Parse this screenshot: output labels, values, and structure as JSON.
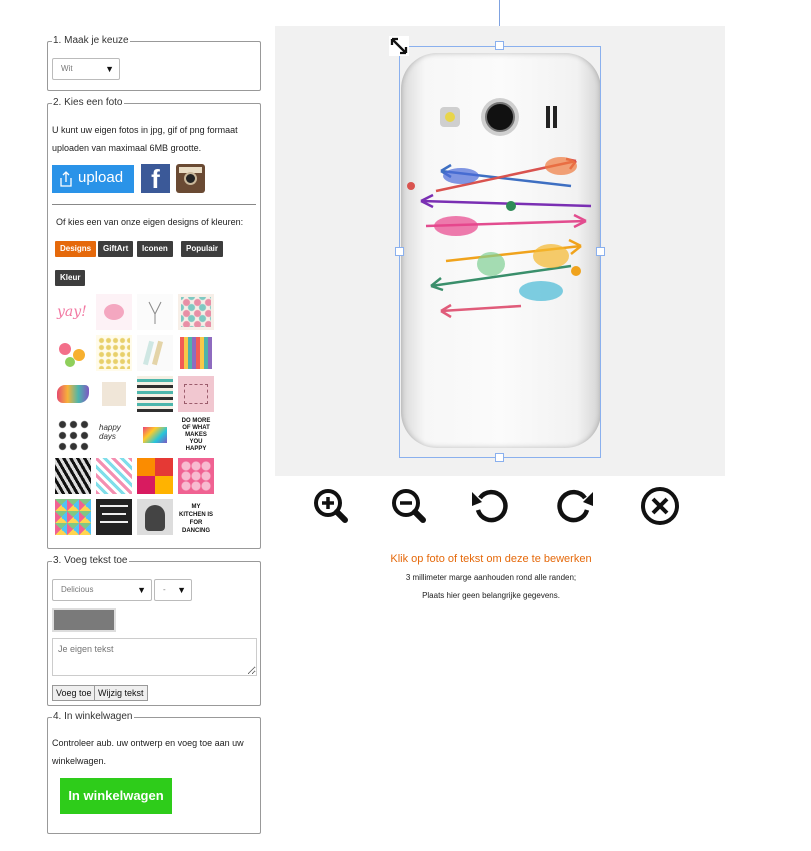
{
  "step1": {
    "legend": "1. Maak je keuze",
    "color_select": "Wit"
  },
  "step2": {
    "legend": "2. Kies een foto",
    "intro": "U kunt uw eigen fotos in jpg, gif of png formaat uploaden van maximaal 6MB grootte.",
    "upload_label": "upload",
    "or_choose": "Of kies een van onze eigen designs of kleuren:",
    "tabs": [
      "Designs",
      "GiftArt",
      "Iconen",
      "Populair",
      "Kleur"
    ],
    "thumb_texts": {
      "yay": "yay!",
      "happy": "happy days",
      "domore": "DO MORE OF WHAT MAKES YOU HAPPY",
      "kitchen": "MY KITCHEN IS FOR DANCING"
    }
  },
  "step3": {
    "legend": "3. Voeg tekst toe",
    "font_select": "Delicious",
    "size_select": "-",
    "text_placeholder": "Je eigen tekst",
    "add_button": "Voeg toe",
    "edit_button": "Wijzig tekst"
  },
  "step4": {
    "legend": "4. In winkelwagen",
    "text": "Controleer aub. uw ontwerp en voeg toe aan uw winkelwagen.",
    "cart_button": "In winkelwagen",
    "cart_color": "#2ecc1a"
  },
  "canvas": {
    "hint": "Klik op foto of tekst om deze te bewerken",
    "margin_note": "3 millimeter marge aanhouden rond alle randen;",
    "important_note": "Plaats hier geen belangrijke gegevens.",
    "accent": "#e5690b"
  },
  "tools": [
    "zoom-in-icon",
    "zoom-out-icon",
    "rotate-left-icon",
    "rotate-right-icon",
    "remove-icon"
  ]
}
